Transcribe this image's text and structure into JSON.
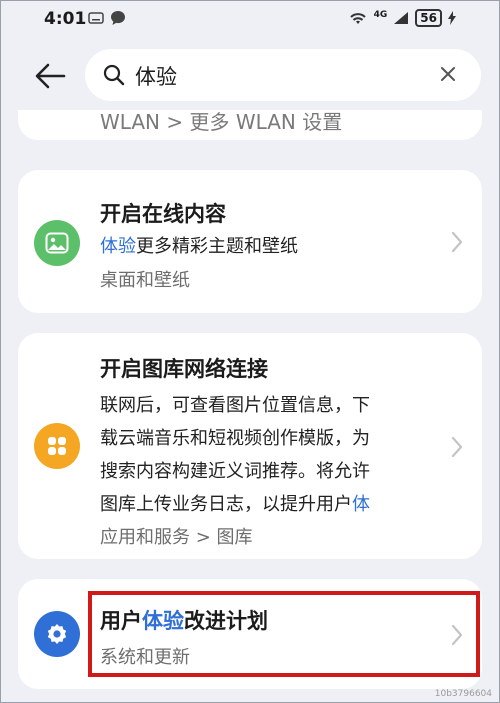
{
  "status_bar": {
    "time": "4:01",
    "network": "4G",
    "battery": "56"
  },
  "search": {
    "query": "体验"
  },
  "results": [
    {
      "partial_breadcrumb": "WLAN > 更多 WLAN 设置"
    },
    {
      "title": "开启在线内容",
      "desc_highlight": "体验",
      "desc_rest": "更多精彩主题和壁纸",
      "path": "桌面和壁纸"
    },
    {
      "title": "开启图库网络连接",
      "desc_lines": [
        "联网后，可查看图片位置信息，下",
        "载云端音乐和短视频创作模版，为",
        "搜索内容构建近义词推荐。将允许"
      ],
      "desc_last_plain": "图库上传业务日志，以提升用户",
      "desc_last_highlight": "体",
      "path": "应用和服务 > 图库"
    },
    {
      "title_pre": "用户",
      "title_highlight": "体验",
      "title_post": "改进计划",
      "path": "系统和更新"
    }
  ],
  "watermark": "10b3796604",
  "colors": {
    "highlight": "#2f6fd6",
    "wallpaper_icon": "#5cbf6a",
    "gallery_icon": "#f5a623",
    "settings_icon": "#2f6fd6",
    "annotation_box": "#d01919"
  }
}
